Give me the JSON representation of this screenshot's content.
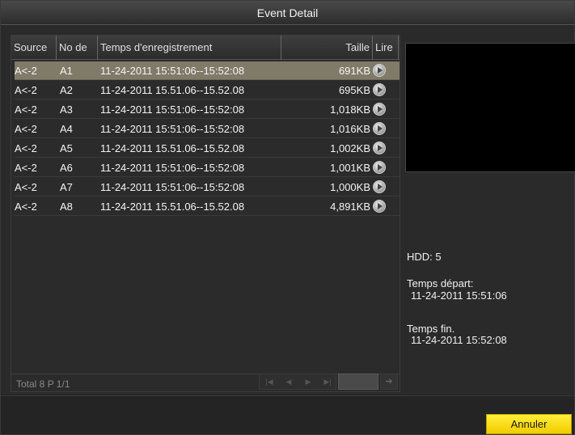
{
  "window": {
    "title": "Event Detail"
  },
  "table": {
    "columns": [
      "Source",
      "No de",
      "Temps d'enregistrement",
      "Taille",
      "Lire"
    ],
    "rows": [
      {
        "source": "A<-2",
        "no": "A1",
        "time": "11-24-2011 15:51:06--15:52:08",
        "size": "691KB",
        "selected": true
      },
      {
        "source": "A<-2",
        "no": "A2",
        "time": "11-24-2011 15.51.06--15.52.08",
        "size": "695KB"
      },
      {
        "source": "A<-2",
        "no": "A3",
        "time": "11-24-2011 15:51:06--15:52:08",
        "size": "1,018KB"
      },
      {
        "source": "A<-2",
        "no": "A4",
        "time": "11-24-2011 15:51:06--15:52:08",
        "size": "1,016KB"
      },
      {
        "source": "A<-2",
        "no": "A5",
        "time": "11-24-2011 15.51.06--15.52.08",
        "size": "1,002KB"
      },
      {
        "source": "A<-2",
        "no": "A6",
        "time": "11-24-2011 15:51:06--15:52:08",
        "size": "1,001KB"
      },
      {
        "source": "A<-2",
        "no": "A7",
        "time": "11-24-2011 15:51:06--15:52:08",
        "size": "1,000KB"
      },
      {
        "source": "A<-2",
        "no": "A8",
        "time": "11-24-2011 15.51.06--15.52.08",
        "size": "4,891KB"
      }
    ],
    "play_icon": "play-circle-icon",
    "total": "Total 8 P 1/1",
    "pager_icons": [
      "first-page-icon",
      "prev-page-icon",
      "next-page-icon",
      "last-page-icon"
    ],
    "page_input_value": "",
    "go_icon": "go-arrow-icon"
  },
  "info": {
    "hdd": "HDD: 5",
    "start_label": "Temps départ:",
    "start_value": "11-24-2011 15:51:06",
    "end_label": "Temps fin.",
    "end_value": "11-24-2011 15:52:08"
  },
  "buttons": {
    "cancel": "Annuler"
  },
  "colors": {
    "selected_row": "#807b68",
    "cancel_button": "#f7dc10"
  }
}
